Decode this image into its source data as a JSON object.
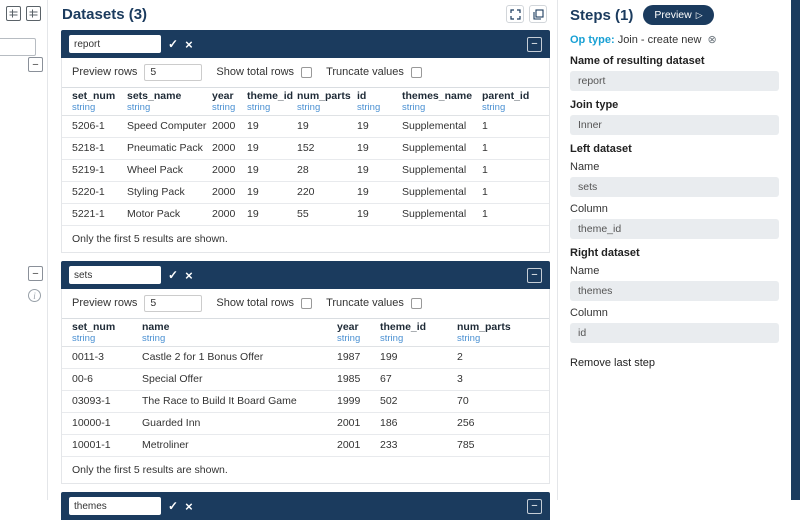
{
  "icons": {
    "confirm": "✓",
    "cancel": "×",
    "collapse": "−",
    "info": "i",
    "preview_play": "▷",
    "remove_op": "⊗"
  },
  "colors": {
    "navy": "#1b3b5e",
    "type_blue": "#4a90d2",
    "op_blue": "#18a0d4"
  },
  "datasets_panel": {
    "title": "Datasets (3)",
    "cards": [
      {
        "name": "report",
        "preview_rows_label": "Preview rows",
        "preview_rows_value": "5",
        "show_total_label": "Show total rows",
        "truncate_label": "Truncate values",
        "note": "Only the first 5 results are shown.",
        "table": {
          "columns": [
            {
              "name": "set_num",
              "type": "string"
            },
            {
              "name": "sets_name",
              "type": "string"
            },
            {
              "name": "year",
              "type": "string"
            },
            {
              "name": "theme_id",
              "type": "string"
            },
            {
              "name": "num_parts",
              "type": "string"
            },
            {
              "name": "id",
              "type": "string"
            },
            {
              "name": "themes_name",
              "type": "string"
            },
            {
              "name": "parent_id",
              "type": "string"
            }
          ],
          "rows": [
            [
              "5206-1",
              "Speed Computer",
              "2000",
              "19",
              "19",
              "19",
              "Supplemental",
              "1"
            ],
            [
              "5218-1",
              "Pneumatic Pack",
              "2000",
              "19",
              "152",
              "19",
              "Supplemental",
              "1"
            ],
            [
              "5219-1",
              "Wheel Pack",
              "2000",
              "19",
              "28",
              "19",
              "Supplemental",
              "1"
            ],
            [
              "5220-1",
              "Styling Pack",
              "2000",
              "19",
              "220",
              "19",
              "Supplemental",
              "1"
            ],
            [
              "5221-1",
              "Motor Pack",
              "2000",
              "19",
              "55",
              "19",
              "Supplemental",
              "1"
            ]
          ]
        }
      },
      {
        "name": "sets",
        "preview_rows_label": "Preview rows",
        "preview_rows_value": "5",
        "show_total_label": "Show total rows",
        "truncate_label": "Truncate values",
        "note": "Only the first 5 results are shown.",
        "table": {
          "columns": [
            {
              "name": "set_num",
              "type": "string"
            },
            {
              "name": "name",
              "type": "string"
            },
            {
              "name": "year",
              "type": "string"
            },
            {
              "name": "theme_id",
              "type": "string"
            },
            {
              "name": "num_parts",
              "type": "string"
            }
          ],
          "rows": [
            [
              "0011-3",
              "Castle 2 for 1 Bonus Offer",
              "1987",
              "199",
              "2"
            ],
            [
              "00-6",
              "Special Offer",
              "1985",
              "67",
              "3"
            ],
            [
              "03093-1",
              "The Race to Build It Board Game",
              "1999",
              "502",
              "70"
            ],
            [
              "10000-1",
              "Guarded Inn",
              "2001",
              "186",
              "256"
            ],
            [
              "10001-1",
              "Metroliner",
              "2001",
              "233",
              "785"
            ]
          ]
        }
      },
      {
        "name": "themes"
      }
    ]
  },
  "steps_panel": {
    "title": "Steps (1)",
    "preview_label": "Preview",
    "op_type_label": "Op type:",
    "op_type_value": "Join - create new",
    "resulting_label": "Name of resulting dataset",
    "resulting_value": "report",
    "join_type_label": "Join type",
    "join_type_value": "Inner",
    "left_dataset_label": "Left dataset",
    "right_dataset_label": "Right dataset",
    "name_label": "Name",
    "column_label": "Column",
    "left_name_value": "sets",
    "left_column_value": "theme_id",
    "right_name_value": "themes",
    "right_column_value": "id",
    "remove_last_step": "Remove last step"
  }
}
